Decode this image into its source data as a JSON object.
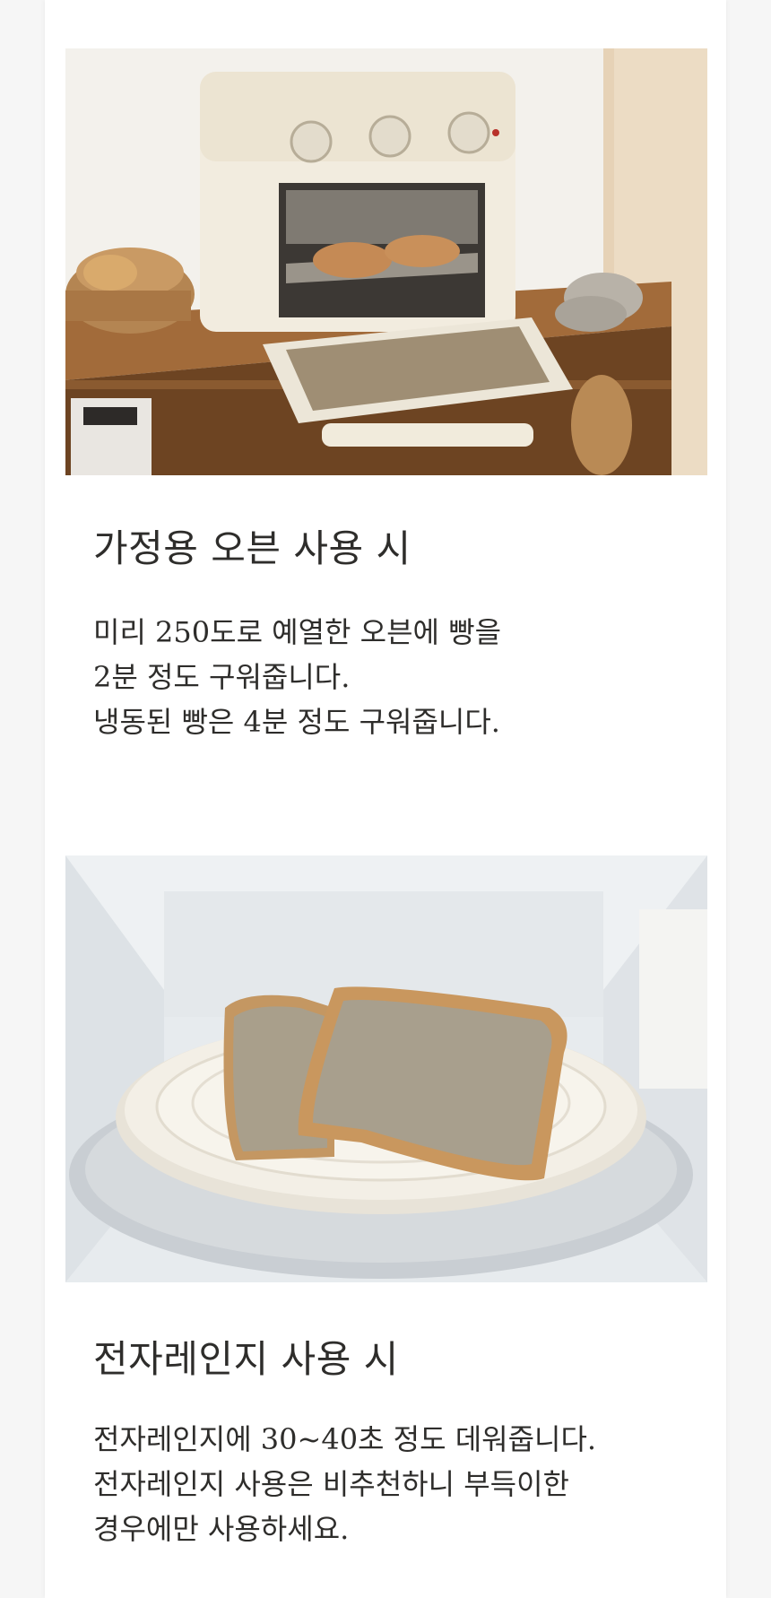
{
  "sections": [
    {
      "image": "toaster-oven-with-bread-toast",
      "title": "가정용 오븐 사용 시",
      "lines": [
        "미리 250도로 예열한 오븐에 빵을",
        "2분 정도 구워줍니다.",
        "냉동된 빵은 4분 정도 구워줍니다."
      ]
    },
    {
      "image": "bread-slices-on-plate-in-microwave",
      "title": "전자레인지 사용 시",
      "lines": [
        "전자레인지에 30~40초 정도 데워줍니다.",
        "전자레인지 사용은 비추천하니 부득이한",
        "경우에만 사용하세요."
      ]
    }
  ],
  "colors": {
    "text": "#2e2d2b",
    "background": "#ffffff",
    "outer": "#f6f6f6"
  }
}
